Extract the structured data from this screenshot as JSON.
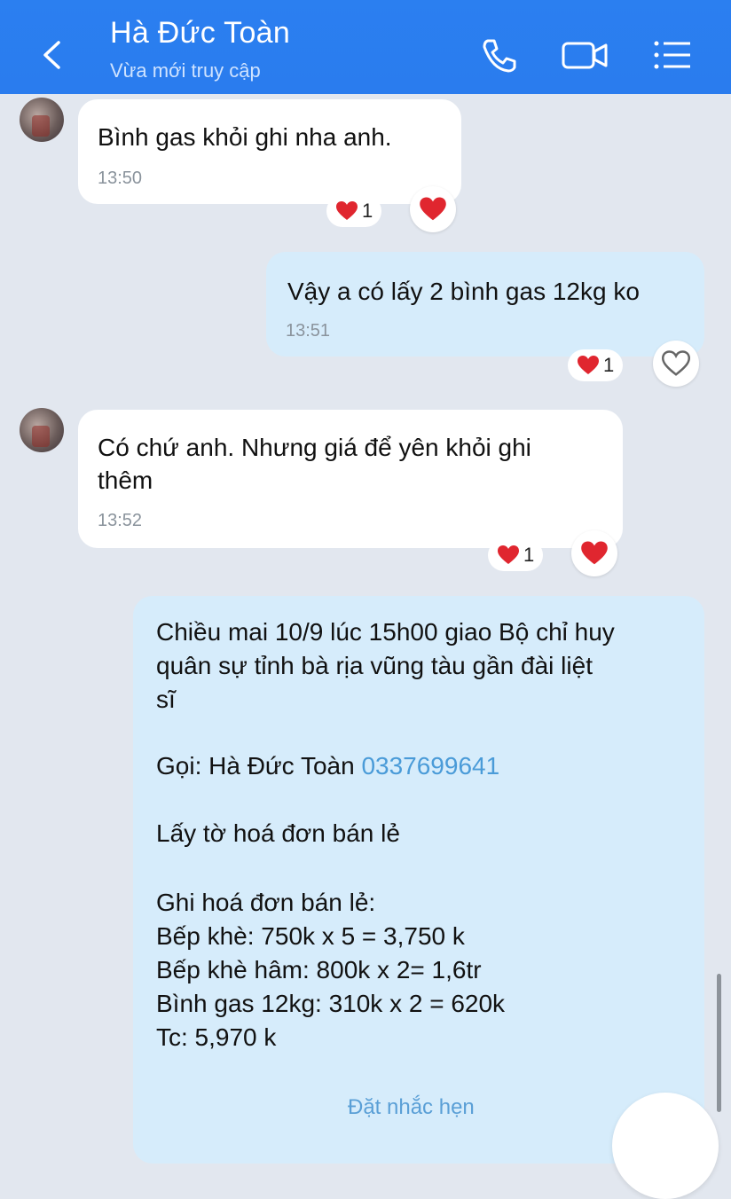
{
  "header": {
    "contact_name": "Hà Đức Toàn",
    "status": "Vừa mới truy cập",
    "icons": [
      "back-icon",
      "phone-icon",
      "video-call-icon",
      "menu-list-icon"
    ]
  },
  "messages": [
    {
      "direction": "incoming",
      "lines": [
        "Bình gas khỏi ghi nha anh."
      ],
      "time": "13:50",
      "reaction_count": "1"
    },
    {
      "direction": "outgoing",
      "lines": [
        "Vậy a có lấy 2 bình gas 12kg ko"
      ],
      "time": "13:51",
      "reaction_count": "1"
    },
    {
      "direction": "incoming",
      "lines": [
        "Có chứ anh. Nhưng giá để yên khỏi ghi",
        "thêm"
      ],
      "time": "13:52",
      "reaction_count": "1"
    },
    {
      "direction": "outgoing",
      "lines": [
        "Chiều mai 10/9 lúc 15h00 giao Bộ chỉ huy",
        "quân sự tỉnh bà rịa vũng tàu gần đài liệt",
        "sĩ",
        "Gọi: Hà Đức Toàn ",
        "Lấy tờ hoá đơn bán lẻ",
        "Ghi hoá đơn bán lẻ:",
        "Bếp khè: 750k x 5 = 3,750 k",
        "Bếp khè hâm: 800k x 2= 1,6tr",
        "Bình gas 12kg: 310k x 2 = 620k",
        "Tc: 5,970 k"
      ],
      "phone": "0337699641",
      "reminder_label": "Đặt nhắc hẹn"
    }
  ],
  "colors": {
    "header": "#2b7ff0",
    "background": "#e2e7ef",
    "outgoing_bubble": "#d6ecfb",
    "incoming_bubble": "#ffffff",
    "heart": "#e0262f",
    "link": "#4a9bd8"
  }
}
